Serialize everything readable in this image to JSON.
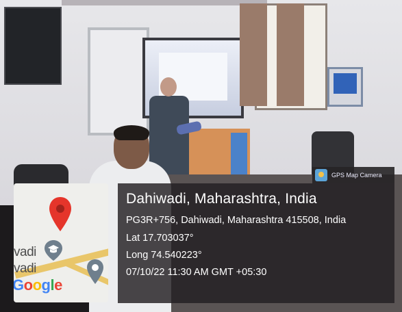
{
  "photo": {
    "description_icons": [
      "tv-icon",
      "projector-screen-icon",
      "podium-icon"
    ]
  },
  "map": {
    "place_line_1": "vadi",
    "place_line_2": "vadi",
    "logo_text": "Google"
  },
  "badge": {
    "label": "GPS Map Camera",
    "icon": "gps-map-camera-icon"
  },
  "location": {
    "city": "Dahiwadi, Maharashtra, India",
    "address": "PG3R+756, Dahiwadi, Maharashtra 415508, India",
    "lat": "Lat 17.703037°",
    "long": "Long 74.540223°",
    "datetime": "07/10/22 11:30 AM GMT +05:30"
  },
  "colors": {
    "overlay_bg": "#221f22",
    "pin_red": "#e5352b",
    "pin_gray": "#6f7f8d"
  }
}
